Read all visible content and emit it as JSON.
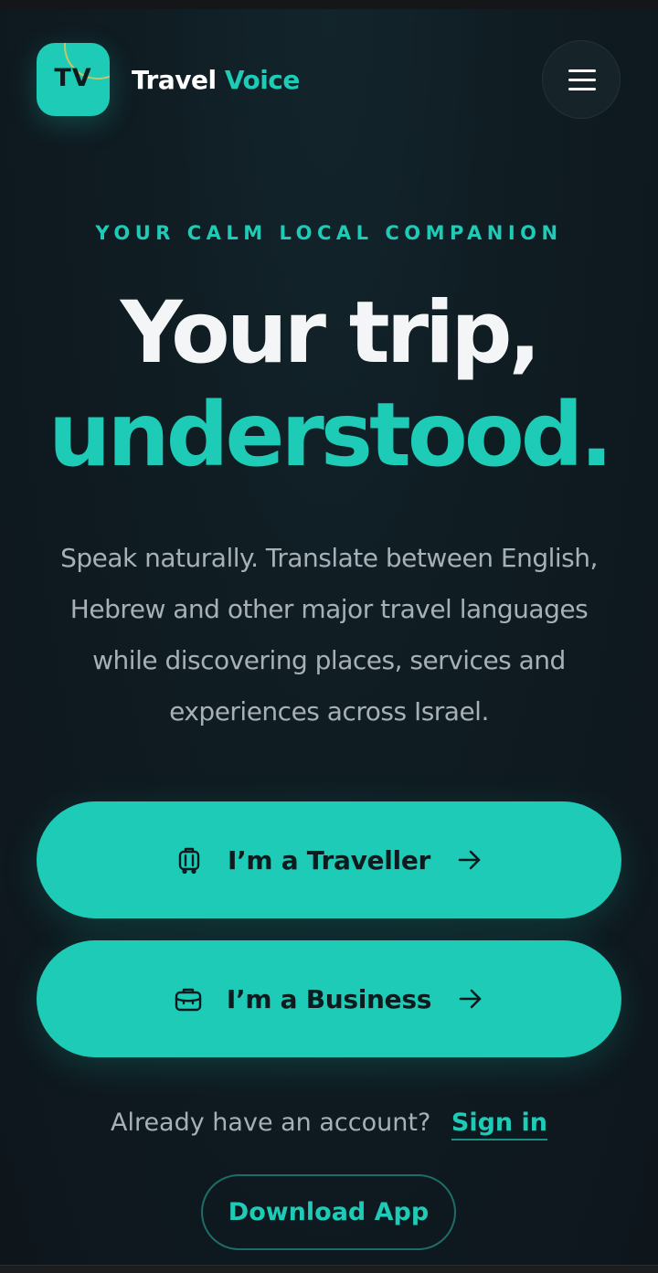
{
  "header": {
    "logo_text": "TV",
    "brand_word1": "Travel",
    "brand_word2": "Voice"
  },
  "hero": {
    "eyebrow": "YOUR CALM LOCAL COMPANION",
    "headline_line1": "Your trip,",
    "headline_line2": "understood.",
    "description": "Speak naturally. Translate between English, Hebrew and other major travel languages while discovering places, services and experiences across Israel."
  },
  "actions": {
    "traveller_label": "I’m a Traveller",
    "business_label": "I’m a Business",
    "account_prompt": "Already have an account?",
    "signin_label": "Sign in",
    "download_label": "Download App"
  },
  "colors": {
    "accent": "#1ecbb6",
    "background": "#0f1a1f",
    "text_muted": "#a7b0b6",
    "button_text": "#0d1b1e"
  },
  "icons": {
    "menu": "hamburger-menu-icon",
    "traveller": "luggage-icon",
    "business": "briefcase-icon",
    "arrow": "arrow-right-icon"
  }
}
